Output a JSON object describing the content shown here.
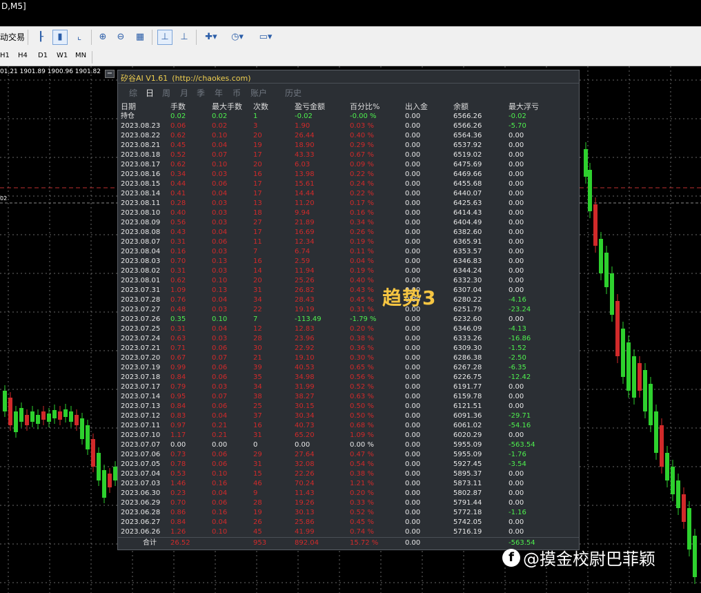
{
  "window": {
    "title": "D,M5]"
  },
  "toolbar": {
    "trade_label": "动交易",
    "timeframes": [
      "H1",
      "H4",
      "D1",
      "W1",
      "MN"
    ]
  },
  "chart": {
    "price_readout": "01,21 1901.89 1900.96 1901.82",
    "price_level": "02"
  },
  "panel": {
    "title": "矽谷AI V1.61",
    "url": "(http://chaokes.com)",
    "tabs": [
      "综",
      "日",
      "周",
      "月",
      "季",
      "年",
      "币",
      "账户",
      "历史"
    ],
    "active_tab": 1,
    "headers": [
      "日期",
      "手数",
      "最大手数",
      "次数",
      "盈亏金额",
      "百分比%",
      "出入金",
      "余额",
      "最大浮亏"
    ],
    "open_row": [
      "持仓",
      "0.02",
      "0.02",
      "1",
      "-0.02",
      "-0.00 %",
      "0.00",
      "6566.26",
      "-0.02"
    ],
    "rows": [
      [
        "2023.08.23",
        "0.06",
        "0.02",
        "3",
        "1.90",
        "0.03 %",
        "0.00",
        "6566.26",
        "-5.70"
      ],
      [
        "2023.08.22",
        "0.62",
        "0.10",
        "20",
        "26.44",
        "0.40 %",
        "0.00",
        "6564.36",
        "0.00"
      ],
      [
        "2023.08.21",
        "0.45",
        "0.04",
        "19",
        "18.90",
        "0.29 %",
        "0.00",
        "6537.92",
        "0.00"
      ],
      [
        "2023.08.18",
        "0.52",
        "0.07",
        "17",
        "43.33",
        "0.67 %",
        "0.00",
        "6519.02",
        "0.00"
      ],
      [
        "2023.08.17",
        "0.62",
        "0.10",
        "20",
        "6.03",
        "0.09 %",
        "0.00",
        "6475.69",
        "0.00"
      ],
      [
        "2023.08.16",
        "0.34",
        "0.03",
        "16",
        "13.98",
        "0.22 %",
        "0.00",
        "6469.66",
        "0.00"
      ],
      [
        "2023.08.15",
        "0.44",
        "0.06",
        "17",
        "15.61",
        "0.24 %",
        "0.00",
        "6455.68",
        "0.00"
      ],
      [
        "2023.08.14",
        "0.41",
        "0.04",
        "17",
        "14.44",
        "0.22 %",
        "0.00",
        "6440.07",
        "0.00"
      ],
      [
        "2023.08.11",
        "0.28",
        "0.03",
        "13",
        "11.20",
        "0.17 %",
        "0.00",
        "6425.63",
        "0.00"
      ],
      [
        "2023.08.10",
        "0.40",
        "0.03",
        "18",
        "9.94",
        "0.16 %",
        "0.00",
        "6414.43",
        "0.00"
      ],
      [
        "2023.08.09",
        "0.56",
        "0.03",
        "27",
        "21.89",
        "0.34 %",
        "0.00",
        "6404.49",
        "0.00"
      ],
      [
        "2023.08.08",
        "0.43",
        "0.04",
        "17",
        "16.69",
        "0.26 %",
        "0.00",
        "6382.60",
        "0.00"
      ],
      [
        "2023.08.07",
        "0.31",
        "0.06",
        "11",
        "12.34",
        "0.19 %",
        "0.00",
        "6365.91",
        "0.00"
      ],
      [
        "2023.08.04",
        "0.16",
        "0.03",
        "7",
        "6.74",
        "0.11 %",
        "0.00",
        "6353.57",
        "0.00"
      ],
      [
        "2023.08.03",
        "0.70",
        "0.13",
        "16",
        "2.59",
        "0.04 %",
        "0.00",
        "6346.83",
        "0.00"
      ],
      [
        "2023.08.02",
        "0.31",
        "0.03",
        "14",
        "11.94",
        "0.19 %",
        "0.00",
        "6344.24",
        "0.00"
      ],
      [
        "2023.08.01",
        "0.62",
        "0.10",
        "20",
        "25.26",
        "0.40 %",
        "0.00",
        "6332.30",
        "0.00"
      ],
      [
        "2023.07.31",
        "1.09",
        "0.13",
        "31",
        "26.82",
        "0.43 %",
        "0.00",
        "6307.04",
        "0.00"
      ],
      [
        "2023.07.28",
        "0.76",
        "0.04",
        "34",
        "28.43",
        "0.45 %",
        "0.00",
        "6280.22",
        "-4.16"
      ],
      [
        "2023.07.27",
        "0.48",
        "0.03",
        "22",
        "19.19",
        "0.31 %",
        "0.00",
        "6251.79",
        "-23.24"
      ],
      [
        "2023.07.26",
        "0.35",
        "0.10",
        "7",
        "-113.49",
        "-1.79 %",
        "0.00",
        "6232.60",
        "0.00"
      ],
      [
        "2023.07.25",
        "0.31",
        "0.04",
        "12",
        "12.83",
        "0.20 %",
        "0.00",
        "6346.09",
        "-4.13"
      ],
      [
        "2023.07.24",
        "0.63",
        "0.03",
        "28",
        "23.96",
        "0.38 %",
        "0.00",
        "6333.26",
        "-16.86"
      ],
      [
        "2023.07.21",
        "0.71",
        "0.06",
        "30",
        "22.92",
        "0.36 %",
        "0.00",
        "6309.30",
        "-1.52"
      ],
      [
        "2023.07.20",
        "0.67",
        "0.07",
        "21",
        "19.10",
        "0.30 %",
        "0.00",
        "6286.38",
        "-2.50"
      ],
      [
        "2023.07.19",
        "0.99",
        "0.06",
        "39",
        "40.53",
        "0.65 %",
        "0.00",
        "6267.28",
        "-6.35"
      ],
      [
        "2023.07.18",
        "0.84",
        "0.06",
        "35",
        "34.98",
        "0.56 %",
        "0.00",
        "6226.75",
        "-12.42"
      ],
      [
        "2023.07.17",
        "0.79",
        "0.03",
        "34",
        "31.99",
        "0.52 %",
        "0.00",
        "6191.77",
        "0.00"
      ],
      [
        "2023.07.14",
        "0.95",
        "0.07",
        "38",
        "38.27",
        "0.63 %",
        "0.00",
        "6159.78",
        "0.00"
      ],
      [
        "2023.07.13",
        "0.84",
        "0.06",
        "25",
        "30.15",
        "0.50 %",
        "0.00",
        "6121.51",
        "0.00"
      ],
      [
        "2023.07.12",
        "0.83",
        "0.04",
        "37",
        "30.34",
        "0.50 %",
        "0.00",
        "6091.36",
        "-29.71"
      ],
      [
        "2023.07.11",
        "0.97",
        "0.21",
        "16",
        "40.73",
        "0.68 %",
        "0.00",
        "6061.02",
        "-54.16"
      ],
      [
        "2023.07.10",
        "1.17",
        "0.21",
        "31",
        "65.20",
        "1.09 %",
        "0.00",
        "6020.29",
        "0.00"
      ],
      [
        "2023.07.07",
        "0.00",
        "0.00",
        "0",
        "0.00",
        "0.00 %",
        "0.00",
        "5955.09",
        "-563.54"
      ],
      [
        "2023.07.06",
        "0.73",
        "0.06",
        "29",
        "27.64",
        "0.47 %",
        "0.00",
        "5955.09",
        "-1.76"
      ],
      [
        "2023.07.05",
        "0.78",
        "0.06",
        "31",
        "32.08",
        "0.54 %",
        "0.00",
        "5927.45",
        "-3.54"
      ],
      [
        "2023.07.04",
        "0.53",
        "0.10",
        "15",
        "22.26",
        "0.38 %",
        "0.00",
        "5895.37",
        "0.00"
      ],
      [
        "2023.07.03",
        "1.46",
        "0.16",
        "46",
        "70.24",
        "1.21 %",
        "0.00",
        "5873.11",
        "0.00"
      ],
      [
        "2023.06.30",
        "0.23",
        "0.04",
        "9",
        "11.43",
        "0.20 %",
        "0.00",
        "5802.87",
        "0.00"
      ],
      [
        "2023.06.29",
        "0.70",
        "0.06",
        "28",
        "19.26",
        "0.33 %",
        "0.00",
        "5791.44",
        "0.00"
      ],
      [
        "2023.06.28",
        "0.86",
        "0.16",
        "19",
        "30.13",
        "0.52 %",
        "0.00",
        "5772.18",
        "-1.16"
      ],
      [
        "2023.06.27",
        "0.84",
        "0.04",
        "26",
        "25.86",
        "0.45 %",
        "0.00",
        "5742.05",
        "0.00"
      ],
      [
        "2023.06.26",
        "1.26",
        "0.10",
        "45",
        "41.99",
        "0.74 %",
        "0.00",
        "5716.19",
        "0.00"
      ]
    ],
    "total_row": {
      "label": "合计",
      "lots": "26.52",
      "count": "953",
      "pnl": "892.04",
      "pct": "15.72 %",
      "deposit": "0.00",
      "drawdown": "-563.54"
    }
  },
  "overlay_text": "趋势3",
  "watermark": {
    "logo": "f",
    "text": "@摸金校尉巴菲颖"
  },
  "colors": {
    "profit": "#d12a2a",
    "loss": "#4ef04e",
    "neutral": "#e8e8e8",
    "title": "#f0d050"
  }
}
